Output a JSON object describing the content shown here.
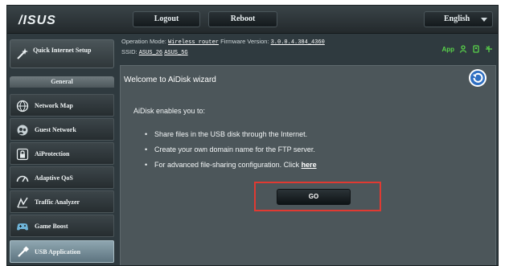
{
  "header": {
    "logo": "/ISUS",
    "logout_label": "Logout",
    "reboot_label": "Reboot",
    "language": "English"
  },
  "info": {
    "operation_mode_label": "Operation Mode:",
    "operation_mode_value": "Wireless router",
    "firmware_label": "Firmware Version:",
    "firmware_value": "3.0.0.4.384_4360",
    "ssid_label": "SSID:",
    "ssid_1": "ASUS_26",
    "ssid_2": "ASUS_5G",
    "app_label": "App"
  },
  "sidebar": {
    "quick_setup_label": "Quick Internet Setup",
    "general_label": "General",
    "items": [
      {
        "label": "Network Map",
        "icon": "globe-icon"
      },
      {
        "label": "Guest Network",
        "icon": "guest-network-icon"
      },
      {
        "label": "AiProtection",
        "icon": "lock-icon"
      },
      {
        "label": "Adaptive QoS",
        "icon": "gauge-icon"
      },
      {
        "label": "Traffic Analyzer",
        "icon": "traffic-analyzer-icon"
      },
      {
        "label": "Game Boost",
        "icon": "gamepad-icon"
      },
      {
        "label": "USB Application",
        "icon": "usb-icon"
      }
    ],
    "active_index": 6
  },
  "content": {
    "title": "Welcome to AiDisk wizard",
    "intro": "AiDisk enables you to:",
    "bullets": [
      "Share files in the USB disk through the Internet.",
      "Create your own domain name for the FTP server.",
      "For advanced file-sharing configuration. Click "
    ],
    "here_link": "here",
    "go_label": "GO"
  },
  "colors": {
    "background": "#2f3a3f",
    "panel": "#4c565a",
    "highlight_box": "#e03a32",
    "status_green": "#59d34a",
    "active_nav": "#8fa6b0"
  }
}
